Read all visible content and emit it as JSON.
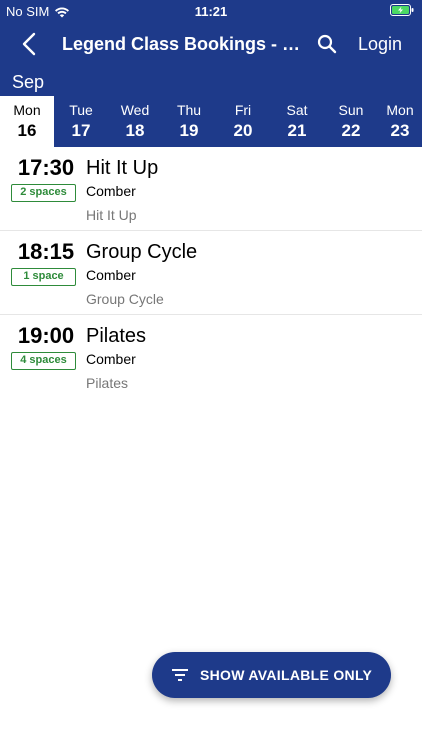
{
  "status_bar": {
    "carrier": "No SIM",
    "time": "11:21"
  },
  "header": {
    "title": "Legend Class Bookings - Comber",
    "login_label": "Login"
  },
  "calendar": {
    "month": "Sep",
    "days": [
      {
        "name": "Mon",
        "num": "16"
      },
      {
        "name": "Tue",
        "num": "17"
      },
      {
        "name": "Wed",
        "num": "18"
      },
      {
        "name": "Thu",
        "num": "19"
      },
      {
        "name": "Fri",
        "num": "20"
      },
      {
        "name": "Sat",
        "num": "21"
      },
      {
        "name": "Sun",
        "num": "22"
      },
      {
        "name": "Mon",
        "num": "23"
      }
    ]
  },
  "classes": [
    {
      "time": "17:30",
      "spaces": "2 spaces",
      "name": "Hit It Up",
      "location": "Comber",
      "category": "Hit It Up"
    },
    {
      "time": "18:15",
      "spaces": "1 space",
      "name": "Group Cycle",
      "location": "Comber",
      "category": "Group Cycle"
    },
    {
      "time": "19:00",
      "spaces": "4 spaces",
      "name": "Pilates",
      "location": "Comber",
      "category": "Pilates"
    }
  ],
  "filter_button": {
    "label": "SHOW AVAILABLE ONLY"
  },
  "colors": {
    "primary": "#1e3a8a",
    "spaces_green": "#2e8b3a",
    "battery_green": "#4cd964"
  }
}
